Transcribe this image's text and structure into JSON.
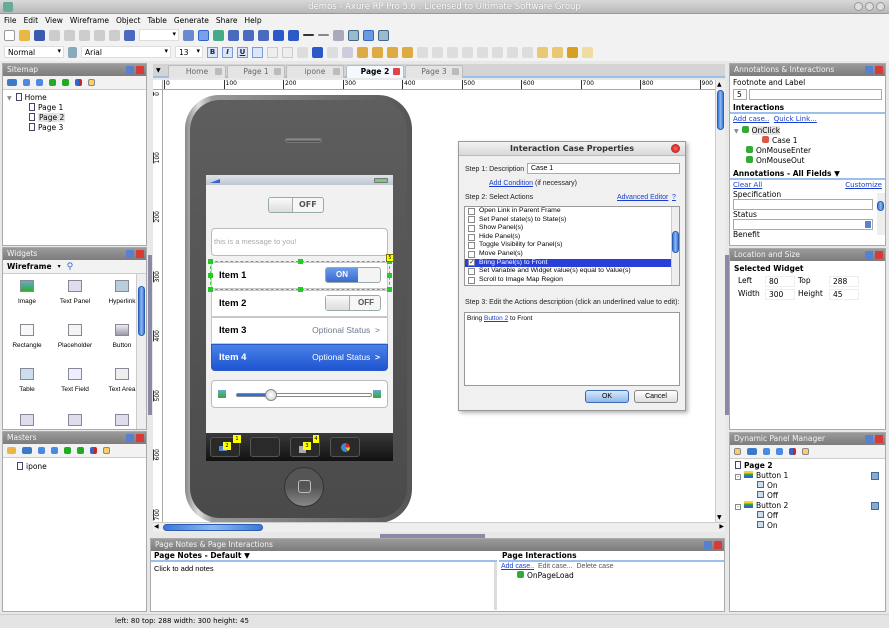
{
  "window": {
    "title": "demos - Axure RP Pro 5.6 : Licensed to Ultimate Software Group"
  },
  "menu": [
    "File",
    "Edit",
    "View",
    "Wireframe",
    "Object",
    "Table",
    "Generate",
    "Share",
    "Help"
  ],
  "format_bar": {
    "style": "Normal",
    "font": "Arial",
    "size": "13",
    "bold": "B",
    "italic": "I",
    "underline": "U"
  },
  "sitemap": {
    "title": "Sitemap",
    "tree": [
      {
        "label": "Home"
      },
      {
        "label": "Page 1"
      },
      {
        "label": "Page 2",
        "selected": true
      },
      {
        "label": "Page 3"
      }
    ]
  },
  "widgets": {
    "title": "Widgets",
    "library": "Wireframe",
    "items": [
      {
        "label": "Image",
        "icon": "image-icon"
      },
      {
        "label": "Text Panel",
        "icon": "text-panel-icon"
      },
      {
        "label": "Hyperlink",
        "icon": "hyperlink-icon"
      },
      {
        "label": "Rectangle",
        "icon": "rectangle-icon"
      },
      {
        "label": "Placeholder",
        "icon": "placeholder-icon"
      },
      {
        "label": "Button",
        "icon": "button-icon"
      },
      {
        "label": "Table",
        "icon": "table-icon"
      },
      {
        "label": "Text Field",
        "icon": "text-field-icon"
      },
      {
        "label": "Text Area",
        "icon": "text-area-icon"
      }
    ]
  },
  "masters": {
    "title": "Masters",
    "items": [
      {
        "label": "ipone"
      }
    ]
  },
  "tabs": [
    {
      "label": "Home"
    },
    {
      "label": "Page 1"
    },
    {
      "label": "ipone"
    },
    {
      "label": "Page 2",
      "active": true
    },
    {
      "label": "Page 3"
    }
  ],
  "ruler": {
    "h_labels": [
      "0",
      "100",
      "200",
      "300",
      "400",
      "500",
      "600",
      "700",
      "800",
      "900"
    ],
    "v_labels": [
      "0",
      "100",
      "200",
      "300",
      "400",
      "500",
      "600",
      "700"
    ]
  },
  "phone": {
    "top_toggle": "OFF",
    "message_placeholder": "this is a message to you!",
    "rows": [
      {
        "label": "Item 1",
        "toggle": "ON"
      },
      {
        "label": "Item 2",
        "toggle": "OFF"
      },
      {
        "label": "Item 3",
        "status": "Optional Status",
        "chevron": ">"
      },
      {
        "label": "Item 4",
        "status": "Optional Status",
        "chevron": ">",
        "highlighted": true
      }
    ],
    "slider_value": 0.25,
    "footnote_badge": "5",
    "tab_badges": [
      "2",
      "1",
      "3",
      "4"
    ]
  },
  "dialog": {
    "title": "Interaction Case Properties",
    "step1_label": "Step 1: Description",
    "description": "Case 1",
    "add_condition": "Add Condition",
    "if_necessary": "(if necessary)",
    "step2_label": "Step 2: Select Actions",
    "advanced_editor": "Advanced Editor",
    "help": "?",
    "actions": [
      {
        "label": "Open Link in Parent Frame",
        "checked": false
      },
      {
        "label": "Set Panel state(s) to State(s)",
        "checked": false
      },
      {
        "label": "Show Panel(s)",
        "checked": false
      },
      {
        "label": "Hide Panel(s)",
        "checked": false
      },
      {
        "label": "Toggle Visibility for Panel(s)",
        "checked": false
      },
      {
        "label": "Move Panel(s)",
        "checked": false
      },
      {
        "label": "Bring Panel(s) to Front",
        "checked": true,
        "selected": true
      },
      {
        "label": "Set Variable and Widget value(s) equal to Value(s)",
        "checked": false
      },
      {
        "label": "Scroll to Image Map Region",
        "checked": false
      }
    ],
    "step3_label": "Step 3: Edit the Actions description (click an underlined value to edit):",
    "desc_pre": "Bring ",
    "desc_link": "Button 2",
    "desc_post": " to Front",
    "ok": "OK",
    "cancel": "Cancel"
  },
  "annotations": {
    "title": "Annotations & Interactions",
    "footnote_label": "Footnote and Label",
    "footnote": "5",
    "label_value": "",
    "interactions_title": "Interactions",
    "add_case": "Add case..",
    "quick_link": "Quick Link...",
    "events": [
      {
        "label": "OnClick",
        "cases": [
          "Case 1"
        ]
      },
      {
        "label": "OnMouseEnter"
      },
      {
        "label": "OnMouseOut"
      }
    ],
    "fields_title": "Annotations - All Fields",
    "clear_all": "Clear All",
    "customize": "Customize",
    "fields": [
      "Specification",
      "Status",
      "Benefit"
    ]
  },
  "location": {
    "title": "Location and Size",
    "heading": "Selected Widget",
    "left_label": "Left",
    "left": "80",
    "top_label": "Top",
    "top": "288",
    "width_label": "Width",
    "width": "300",
    "height_label": "Height",
    "height": "45"
  },
  "dpm": {
    "title": "Dynamic Panel Manager",
    "page": "Page 2",
    "panels": [
      {
        "label": "Button 1",
        "states": [
          "On",
          "Off"
        ]
      },
      {
        "label": "Button 2",
        "states": [
          "Off",
          "On"
        ]
      }
    ]
  },
  "page_notes": {
    "title": "Page Notes & Page Interactions",
    "notes_title": "Page Notes - Default",
    "notes_placeholder": "Click to add notes",
    "interactions_title": "Page Interactions",
    "add_case": "Add case..",
    "edit_case": "Edit case...",
    "delete_case": "Delete case",
    "events": [
      "OnPageLoad"
    ]
  },
  "status": "left: 80   top: 288   width: 300   height: 45"
}
